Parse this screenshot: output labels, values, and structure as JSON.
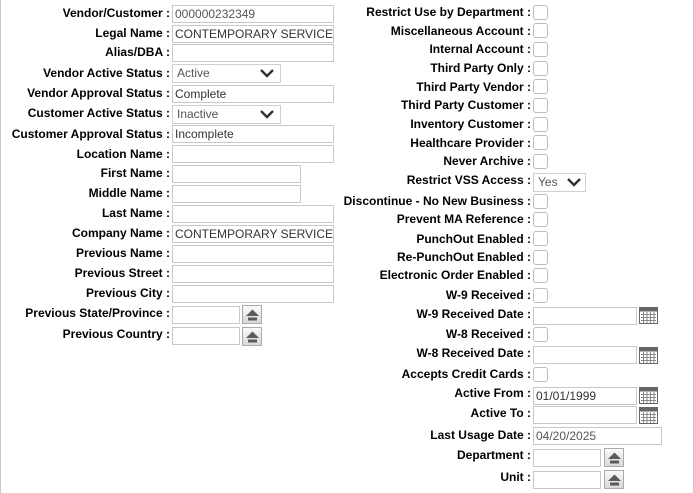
{
  "left_fields": [
    {
      "label": "Vendor/Customer :",
      "value": "000000232349"
    },
    {
      "label": "Legal Name :",
      "value": "CONTEMPORARY SERVICES"
    },
    {
      "label": "Alias/DBA :",
      "value": ""
    },
    {
      "label": "Vendor Active Status :",
      "value": "Active"
    },
    {
      "label": "Vendor Approval Status :",
      "value": "Complete"
    },
    {
      "label": "Customer Active Status :",
      "value": "Inactive"
    },
    {
      "label": "Customer Approval Status :",
      "value": "Incomplete"
    },
    {
      "label": "Location Name :",
      "value": ""
    },
    {
      "label": "First Name :",
      "value": ""
    },
    {
      "label": "Middle Name :",
      "value": ""
    },
    {
      "label": "Last Name :",
      "value": ""
    },
    {
      "label": "Company Name :",
      "value": "CONTEMPORARY SERVICES"
    },
    {
      "label": "Previous Name :",
      "value": ""
    },
    {
      "label": "Previous Street :",
      "value": ""
    },
    {
      "label": "Previous City :",
      "value": ""
    },
    {
      "label": "Previous State/Province :",
      "value": ""
    },
    {
      "label": "Previous Country :",
      "value": ""
    }
  ],
  "right_fields": [
    {
      "label": "Restrict Use by Department :",
      "checked": false
    },
    {
      "label": "Miscellaneous Account :",
      "checked": false
    },
    {
      "label": "Internal Account :",
      "checked": false
    },
    {
      "label": "Third Party Only :",
      "checked": false
    },
    {
      "label": "Third Party Vendor :",
      "checked": false
    },
    {
      "label": "Third Party Customer :",
      "checked": false
    },
    {
      "label": "Inventory Customer :",
      "checked": false
    },
    {
      "label": "Healthcare Provider :",
      "checked": false
    },
    {
      "label": "Never Archive :",
      "checked": false
    },
    {
      "label": "Restrict VSS Access :",
      "value": "Yes"
    },
    {
      "label": "Discontinue - No New Business :",
      "checked": false
    },
    {
      "label": "Prevent MA Reference :",
      "checked": false
    },
    {
      "label": "PunchOut Enabled :",
      "checked": false
    },
    {
      "label": "Re-PunchOut Enabled :",
      "checked": false
    },
    {
      "label": "Electronic Order Enabled :",
      "checked": false
    },
    {
      "label": "W-9 Received :",
      "checked": false
    },
    {
      "label": "W-9 Received Date :",
      "value": ""
    },
    {
      "label": "W-8 Received :",
      "checked": false
    },
    {
      "label": "W-8 Received Date :",
      "value": ""
    },
    {
      "label": "Accepts Credit Cards :",
      "checked": false
    },
    {
      "label": "Active From :",
      "value": "01/01/1999"
    },
    {
      "label": "Active To :",
      "value": ""
    },
    {
      "label": "Last Usage Date :",
      "value": "04/20/2025"
    },
    {
      "label": "Department :",
      "value": ""
    },
    {
      "label": "Unit :",
      "value": ""
    }
  ],
  "icons": {
    "lookup": "lookup-icon",
    "calendar": "calendar-icon",
    "dropdown": "chevron-down-icon"
  }
}
